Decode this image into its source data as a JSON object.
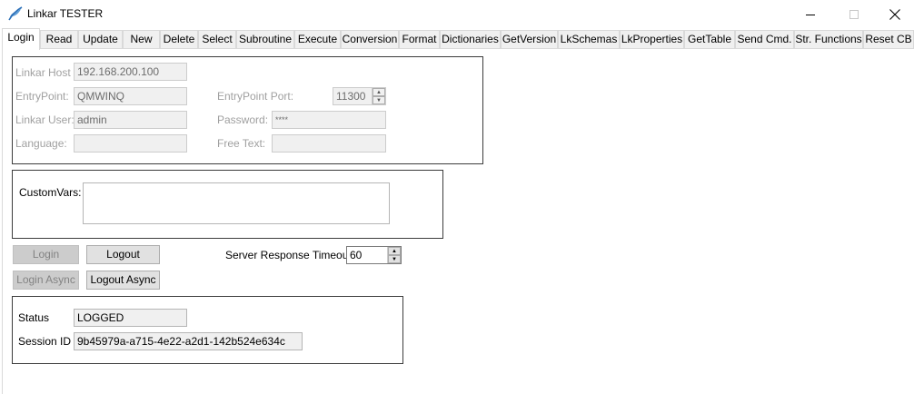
{
  "window": {
    "title": "Linkar TESTER",
    "icon": "feather-icon",
    "controls": [
      "minimize-icon",
      "maximize-icon",
      "close-icon"
    ]
  },
  "tabs": [
    "Login",
    "Read",
    "Update",
    "New",
    "Delete",
    "Select",
    "Subroutine",
    "Execute",
    "Conversion",
    "Format",
    "Dictionaries",
    "GetVersion",
    "LkSchemas",
    "LkProperties",
    "GetTable",
    "Send Cmd.",
    "Str. Functions",
    "Reset CB"
  ],
  "active_tab": "Login",
  "connection": {
    "host_label": "Linkar Host",
    "host_value": "192.168.200.100",
    "entrypoint_label": "EntryPoint:",
    "entrypoint_value": "QMWINQ",
    "port_label": "EntryPoint Port:",
    "port_value": "11300",
    "user_label": "Linkar User:",
    "user_value": "admin",
    "password_label": "Password:",
    "password_value": "****",
    "language_label": "Language:",
    "language_value": "",
    "freetext_label": "Free Text:",
    "freetext_value": ""
  },
  "customvars": {
    "label": "CustomVars:",
    "value": ""
  },
  "actions": {
    "login": "Login",
    "logout": "Logout",
    "login_async": "Login Async",
    "logout_async": "Logout Async",
    "timeout_label": "Server Response Timeout",
    "timeout_value": "60"
  },
  "status": {
    "status_label": "Status",
    "status_value": "LOGGED",
    "session_label": "Session ID",
    "session_value": "9b45979a-a715-4e22-a2d1-142b524e634c"
  }
}
